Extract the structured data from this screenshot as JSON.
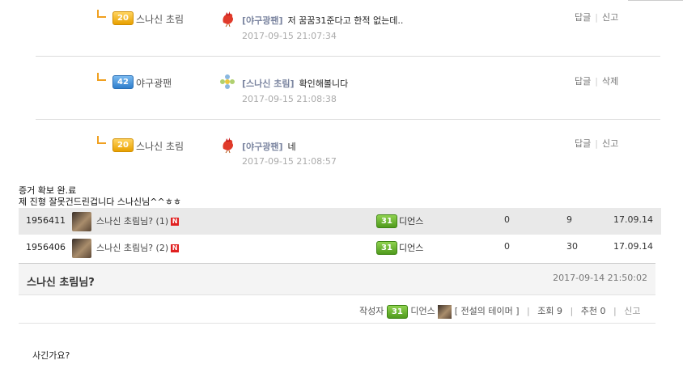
{
  "replies": [
    {
      "level": "20",
      "user": "스나신 초림",
      "tag": "[야구광팬]",
      "text": "저 꿈꿈31준다고 한적 없는데..",
      "time": "2017-09-15 21:07:34",
      "action1": "답글",
      "action2": "신고",
      "avatar_icon": "rooster-icon"
    },
    {
      "level": "42",
      "user": "야구광팬",
      "tag": "[스나신 초림]",
      "text": "확인해볼니다",
      "time": "2017-09-15 21:08:38",
      "action1": "답글",
      "action2": "삭제",
      "avatar_icon": "flower-icon"
    },
    {
      "level": "20",
      "user": "스나신 초림",
      "tag": "[야구광팬]",
      "text": "네",
      "time": "2017-09-15 21:08:57",
      "action1": "답글",
      "action2": "신고",
      "avatar_icon": "rooster-icon"
    }
  ],
  "evidence": [
    "증거 확보 완.료",
    "제 진형 잘못건드린겁니다 스나신님^^ㅎㅎ"
  ],
  "rows": [
    {
      "id": "1956411",
      "title": "스나신 초림님? (1)",
      "new_badge": "N",
      "level": "31",
      "writer": "디언스",
      "col1": "0",
      "col2": "9",
      "date": "17.09.14"
    },
    {
      "id": "1956406",
      "title": "스나신 초림님? (2)",
      "new_badge": "N",
      "level": "31",
      "writer": "디언스",
      "col1": "0",
      "col2": "30",
      "date": "17.09.14"
    }
  ],
  "post": {
    "title": "스나신 초림님?",
    "date": "2017-09-14 21:50:02",
    "author_label": "작성자",
    "author_level": "31",
    "author_name": "디언스",
    "author_title": "[ 전설의 테이머 ]",
    "views": "조회 9",
    "recommend": "추천 0",
    "report": "신고",
    "body": "사긴가요?"
  },
  "colors": {
    "gold_badge": "#e8a000",
    "blue_badge": "#2f7fcc",
    "green_badge": "#4f9a1c",
    "new_badge": "#e02020",
    "row_highlight": "#e9e9e9"
  }
}
